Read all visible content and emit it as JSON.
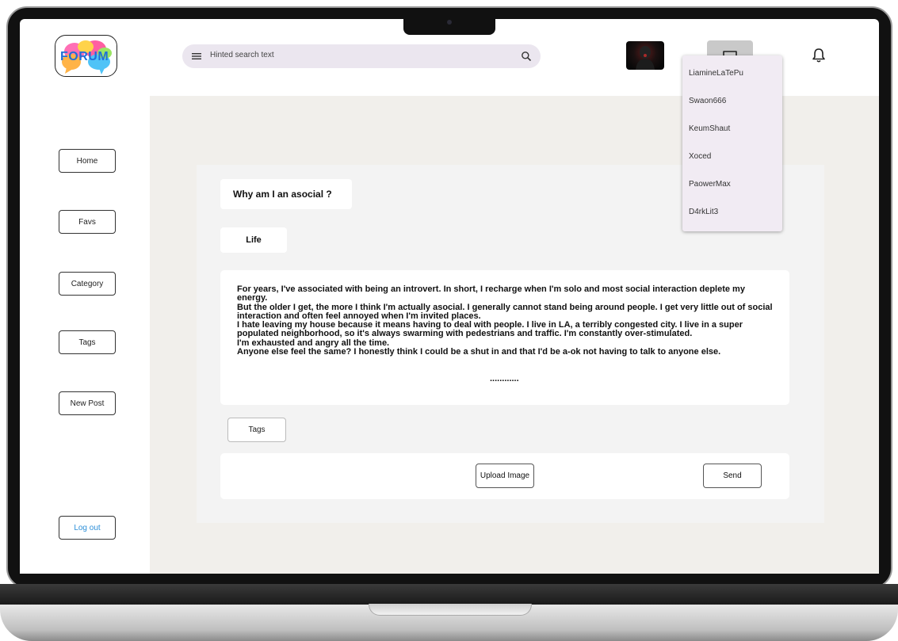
{
  "header": {
    "logo_text": "FORUM",
    "search": {
      "placeholder": "Hinted search text",
      "menu_icon": "menu-icon",
      "search_icon": "search-icon"
    },
    "chat_icon": "chat-icon",
    "bell_icon": "bell-icon"
  },
  "chat_dropdown": {
    "items": [
      "LiamineLaTePu",
      "Swaon666",
      "KeumShaut",
      "Xoced",
      "PaowerMax",
      "D4rkLit3"
    ]
  },
  "sidebar": {
    "items": [
      {
        "label": "Home"
      },
      {
        "label": "Favs"
      },
      {
        "label": "Category"
      },
      {
        "label": "Tags"
      },
      {
        "label": "New Post"
      }
    ],
    "logout_label": "Log out",
    "logout_color": "#2d8fd8"
  },
  "post": {
    "title": "Why am I an asocial ?",
    "category": "Life",
    "body_lines": [
      "For years, I've associated with being an introvert. In short, I recharge when I'm solo and most social interaction deplete my energy.",
      "But the older I get, the more I think I'm actually asocial. I generally cannot stand being around people. I get very little out of social interaction and often feel annoyed when I'm invited places.",
      "I hate leaving my house because it means having to deal with people. I live in LA, a terribly congested city. I live in a super populated neighborhood, so it's always swarming with pedestrians and traffic. I'm constantly over-stimulated.",
      "I'm exhausted and angry all the time.",
      "Anyone else feel the same? I honestly think I could be a shut in and that I'd be a-ok not having to talk to anyone else."
    ],
    "ellipsis": "............",
    "tags_label": "Tags",
    "upload_label": "Upload Image",
    "send_label": "Send"
  }
}
